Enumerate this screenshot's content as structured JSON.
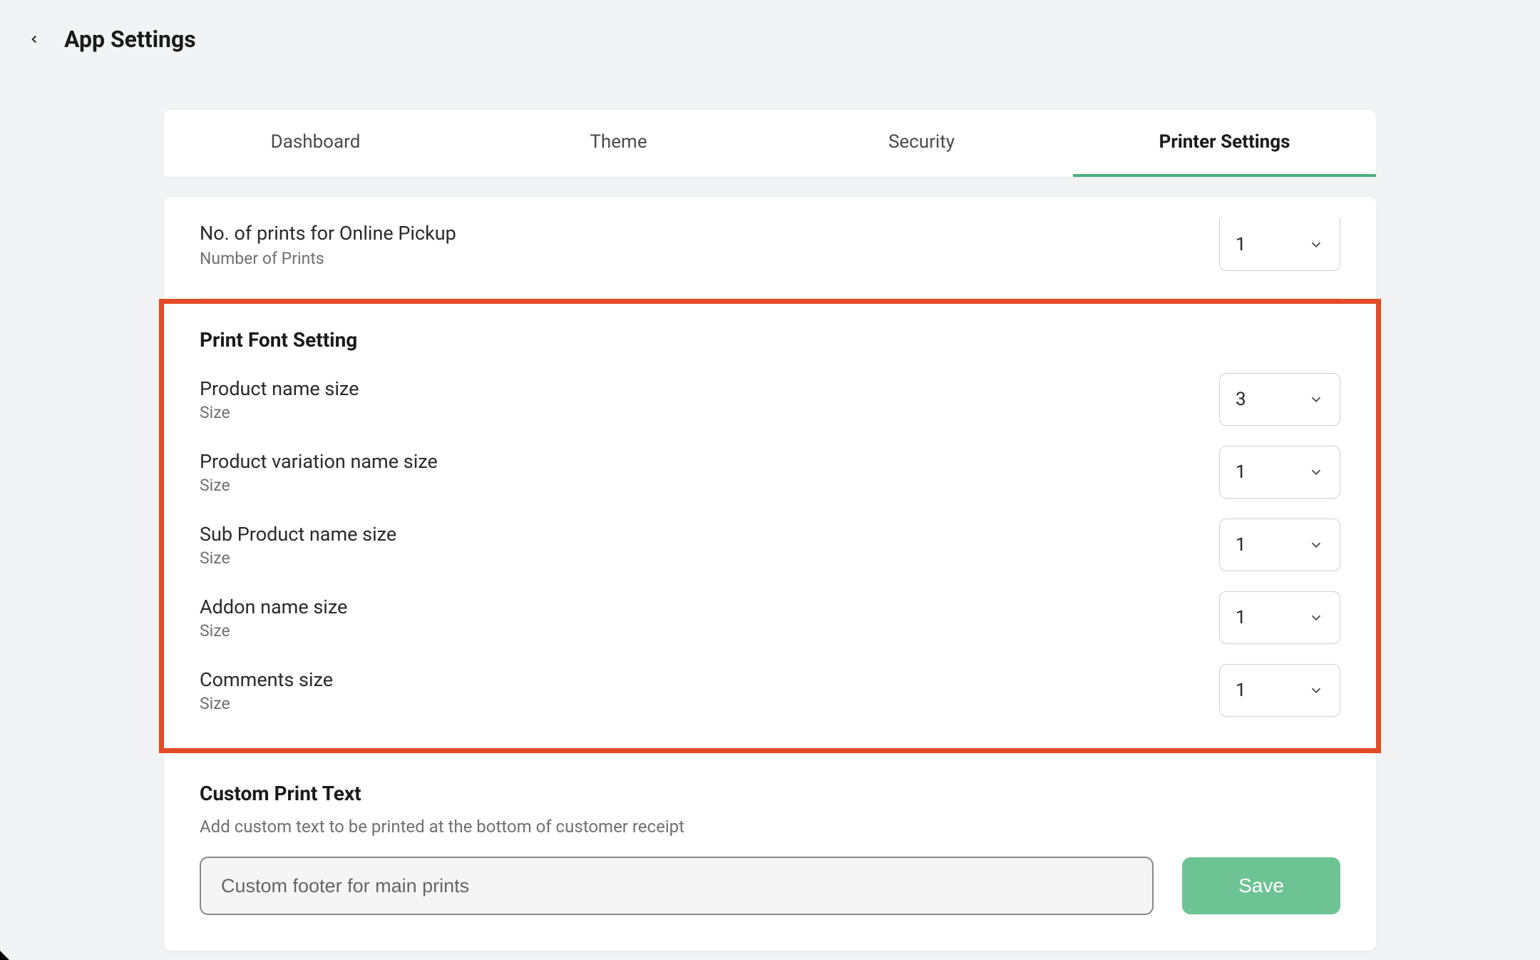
{
  "header": {
    "title": "App Settings"
  },
  "tabs": [
    {
      "label": "Dashboard",
      "active": false
    },
    {
      "label": "Theme",
      "active": false
    },
    {
      "label": "Security",
      "active": false
    },
    {
      "label": "Printer Settings",
      "active": true
    }
  ],
  "prints_row": {
    "title": "No. of prints for Online Pickup",
    "sub": "Number of Prints",
    "value": "1"
  },
  "font_section": {
    "title": "Print Font Setting",
    "rows": [
      {
        "title": "Product name size",
        "sub": "Size",
        "value": "3"
      },
      {
        "title": "Product variation name size",
        "sub": "Size",
        "value": "1"
      },
      {
        "title": "Sub Product name size",
        "sub": "Size",
        "value": "1"
      },
      {
        "title": "Addon name size",
        "sub": "Size",
        "value": "1"
      },
      {
        "title": "Comments size",
        "sub": "Size",
        "value": "1"
      }
    ]
  },
  "custom_print": {
    "title": "Custom Print Text",
    "sub": "Add custom text to be printed at the bottom of customer receipt",
    "placeholder": "Custom footer for main prints",
    "save_label": "Save"
  }
}
